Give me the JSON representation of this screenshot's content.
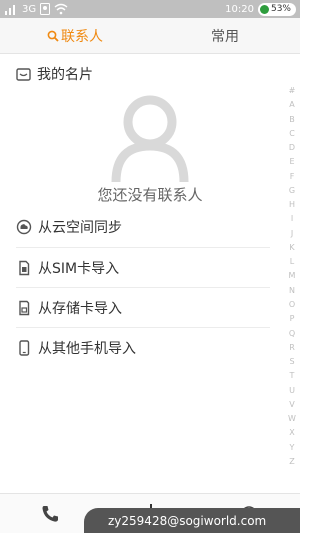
{
  "status_bar": {
    "network": "3G",
    "time": "10:20",
    "battery": "53%"
  },
  "tabs": [
    {
      "label": "联系人",
      "active": true
    },
    {
      "label": "常用",
      "active": false
    }
  ],
  "my_card": {
    "label": "我的名片"
  },
  "empty_state": {
    "text": "您还没有联系人"
  },
  "import_options": [
    {
      "label": "从云空间同步",
      "icon": "cloud-sync-icon"
    },
    {
      "label": "从SIM卡导入",
      "icon": "sim-card-icon"
    },
    {
      "label": "从存储卡导入",
      "icon": "sd-card-icon"
    },
    {
      "label": "从其他手机导入",
      "icon": "phone-icon"
    }
  ],
  "alphabet_index": [
    "#",
    "A",
    "B",
    "C",
    "D",
    "E",
    "F",
    "G",
    "H",
    "I",
    "J",
    "K",
    "L",
    "M",
    "N",
    "O",
    "P",
    "Q",
    "R",
    "S",
    "T",
    "U",
    "V",
    "W",
    "X",
    "Y",
    "Z"
  ],
  "bottom_bar": {
    "watermark": "zy259428@sogiworld.com"
  },
  "colors": {
    "accent": "#f08a12",
    "status_bar": "#bfbfbf",
    "battery_green": "#2e9d3d"
  }
}
